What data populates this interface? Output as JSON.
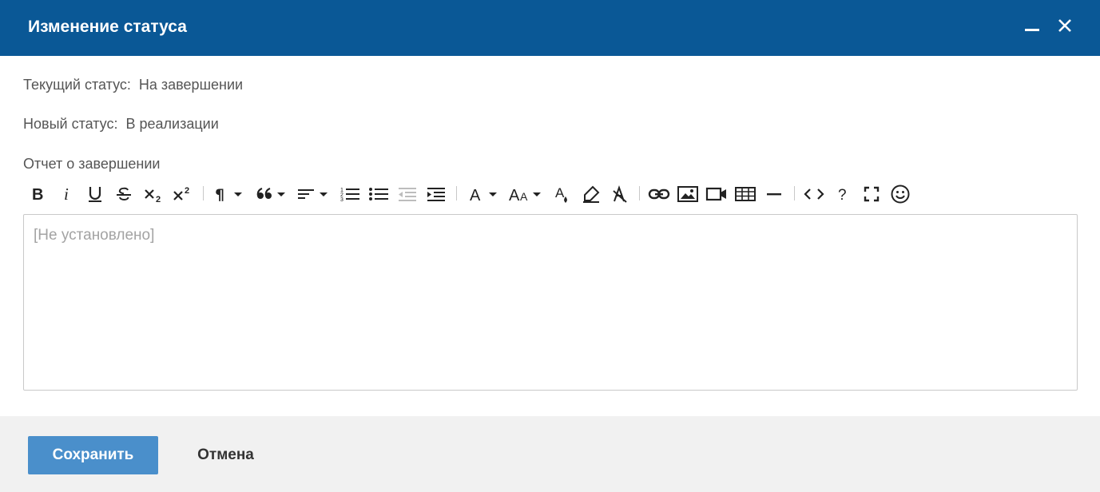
{
  "dialog": {
    "title": "Изменение статуса",
    "minimize_icon": "minimize-icon",
    "close_icon": "close-icon"
  },
  "current_status": {
    "label": "Текущий статус:",
    "value": "На завершении"
  },
  "new_status": {
    "label": "Новый статус:",
    "value": "В реализации"
  },
  "report": {
    "label": "Отчет о завершении",
    "placeholder": "[Не установлено]",
    "value": ""
  },
  "toolbar": {
    "buttons": [
      {
        "name": "bold-icon",
        "text": "B"
      },
      {
        "name": "italic-icon",
        "text": "i"
      },
      {
        "name": "underline-icon",
        "text": "U"
      },
      {
        "name": "strikethrough-icon",
        "text": "S"
      },
      {
        "name": "subscript-icon",
        "text": "×₂"
      },
      {
        "name": "superscript-icon",
        "text": "×²"
      },
      {
        "name": "paragraph-format-icon",
        "text": "¶"
      },
      {
        "name": "quote-icon",
        "text": "❝"
      },
      {
        "name": "align-icon",
        "text": ""
      },
      {
        "name": "ordered-list-icon",
        "text": ""
      },
      {
        "name": "unordered-list-icon",
        "text": ""
      },
      {
        "name": "outdent-icon",
        "text": ""
      },
      {
        "name": "indent-icon",
        "text": ""
      },
      {
        "name": "font-family-icon",
        "text": "A"
      },
      {
        "name": "font-size-icon",
        "text": "AA"
      },
      {
        "name": "text-color-icon",
        "text": ""
      },
      {
        "name": "highlight-icon",
        "text": ""
      },
      {
        "name": "clear-formatting-icon",
        "text": ""
      },
      {
        "name": "link-icon",
        "text": ""
      },
      {
        "name": "image-icon",
        "text": ""
      },
      {
        "name": "video-icon",
        "text": ""
      },
      {
        "name": "table-icon",
        "text": ""
      },
      {
        "name": "horizontal-line-icon",
        "text": ""
      },
      {
        "name": "code-view-icon",
        "text": "<>"
      },
      {
        "name": "help-icon",
        "text": "?"
      },
      {
        "name": "fullscreen-icon",
        "text": ""
      },
      {
        "name": "emoticons-icon",
        "text": ""
      }
    ]
  },
  "footer": {
    "save_label": "Сохранить",
    "cancel_label": "Отмена"
  },
  "colors": {
    "titlebar": "#0a5896",
    "save_button": "#4a8fcb",
    "footer_bg": "#f1f1f1",
    "placeholder": "#a3a3a3",
    "label_text": "#555555"
  }
}
